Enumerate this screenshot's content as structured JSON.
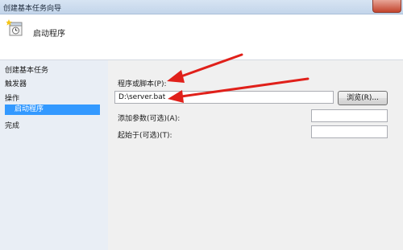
{
  "window": {
    "title": "创建基本任务向导"
  },
  "header": {
    "title": "启动程序"
  },
  "sidebar": {
    "items": [
      {
        "label": "创建基本任务"
      },
      {
        "label": "触发器"
      },
      {
        "label": "操作"
      },
      {
        "label": "启动程序"
      },
      {
        "label": "完成"
      }
    ]
  },
  "form": {
    "program_label": "程序或脚本(P):",
    "program_value": "D:\\server.bat",
    "browse_label": "浏览(R)...",
    "args_label": "添加参数(可选)(A):",
    "args_value": "",
    "start_label": "起始于(可选)(T):",
    "start_value": ""
  },
  "colors": {
    "arrow": "#e0201a",
    "selection": "#3399ff"
  }
}
